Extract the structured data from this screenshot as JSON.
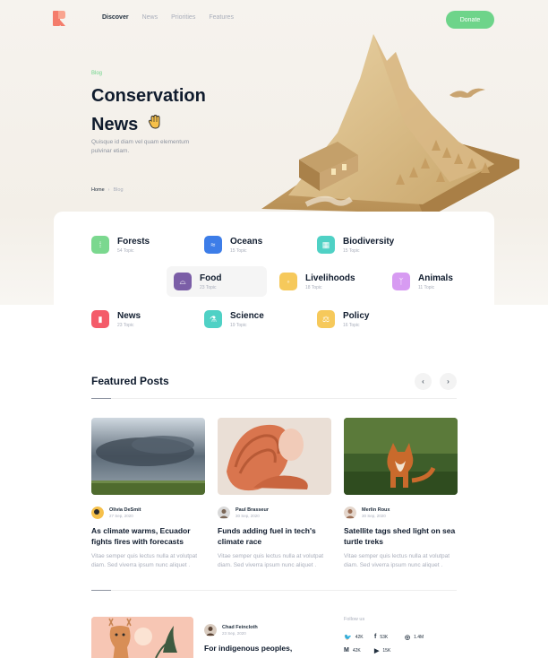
{
  "nav": {
    "items": [
      {
        "label": "Discover",
        "active": true
      },
      {
        "label": "News",
        "active": false
      },
      {
        "label": "Priorities",
        "active": false
      },
      {
        "label": "Features",
        "active": false
      }
    ],
    "donate_label": "Donate"
  },
  "hero": {
    "tag": "Blog",
    "title_line1": "Conservation",
    "title_line2": "News",
    "subtitle": "Quisque id diam vel quam elementum pulvinar etiam.",
    "breadcrumb": {
      "home": "Home",
      "current": "Blog"
    }
  },
  "topics": [
    {
      "name": "Forests",
      "count": "54 Topic",
      "color": "#7bd88f",
      "icon": "leaf-icon"
    },
    {
      "name": "Oceans",
      "count": "15 Topic",
      "color": "#3d7de8",
      "icon": "wave-icon"
    },
    {
      "name": "Biodiversity",
      "count": "15 Topic",
      "color": "#4fd1c5",
      "icon": "pattern-icon"
    },
    {
      "name": "Food",
      "count": "23 Topic",
      "color": "#7b5ea7",
      "icon": "dish-icon"
    },
    {
      "name": "Livelihoods",
      "count": "18 Topic",
      "color": "#f6c95b",
      "icon": "bulb-icon"
    },
    {
      "name": "Animals",
      "count": "11 Topic",
      "color": "#d79bf2",
      "icon": "paw-icon"
    },
    {
      "name": "News",
      "count": "23 Topic",
      "color": "#f45b69",
      "icon": "document-icon"
    },
    {
      "name": "Science",
      "count": "19 Topic",
      "color": "#4fd1c5",
      "icon": "flask-icon"
    },
    {
      "name": "Policy",
      "count": "16 Topic",
      "color": "#f6c95b",
      "icon": "scale-icon"
    }
  ],
  "featured": {
    "title": "Featured Posts",
    "prev": "‹",
    "next": "›",
    "posts": [
      {
        "author": "Olivia DeSmit",
        "date": "27 Sep, 2020",
        "title": "As climate warms, Ecuador fights fires with forecasts",
        "excerpt": "Vitae semper quis lectus nulla at volutpat diam. Sed viverra ipsum nunc aliquet ."
      },
      {
        "author": "Paul Brasseur",
        "date": "30 Sep, 2020",
        "title": "Funds adding fuel in tech's climate race",
        "excerpt": "Vitae semper quis lectus nulla at volutpat diam. Sed viverra ipsum nunc aliquet ."
      },
      {
        "author": "Merlin Roux",
        "date": "30 Sep, 2020",
        "title": "Satellite tags shed light on sea turtle treks",
        "excerpt": "Vitae semper quis lectus nulla at volutpat diam. Sed viverra ipsum nunc aliquet ."
      }
    ]
  },
  "second_post": {
    "author": "Chad Feincloth",
    "date": "23 Sep, 2020",
    "title": "For indigenous peoples,"
  },
  "follow": {
    "label": "Follow us",
    "items": [
      {
        "icon": "twitter-icon",
        "glyph": "🐦",
        "count": "42K"
      },
      {
        "icon": "facebook-icon",
        "glyph": "f",
        "count": "53K"
      },
      {
        "icon": "instagram-icon",
        "glyph": "◎",
        "count": "1.4M"
      },
      {
        "icon": "medium-icon",
        "glyph": "M",
        "count": "42K"
      },
      {
        "icon": "youtube-icon",
        "glyph": "▶",
        "count": "15K"
      }
    ]
  }
}
